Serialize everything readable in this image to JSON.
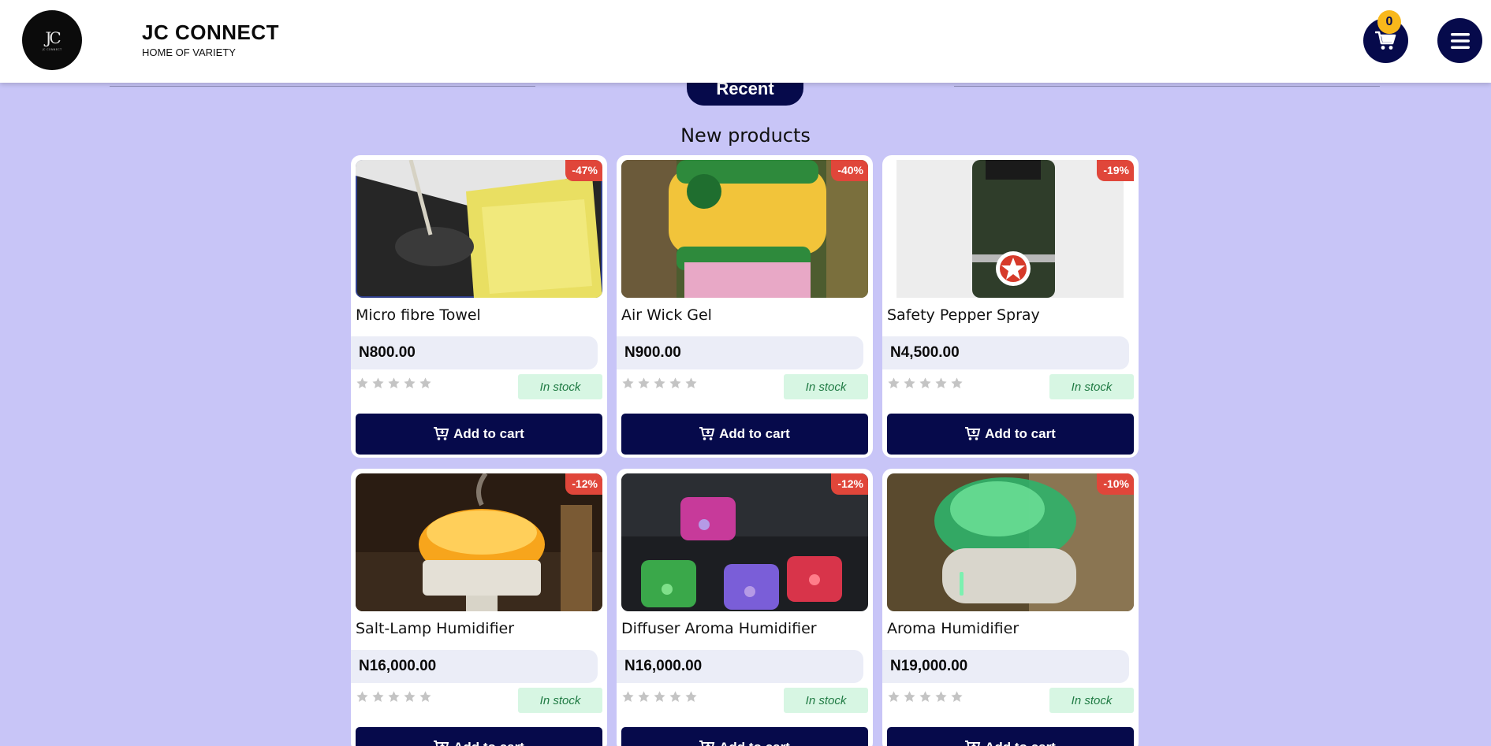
{
  "header": {
    "logo_mark": "JC",
    "logo_text": "JC CONNECT",
    "title": "JC CONNECT",
    "tagline": "HOME OF VARIETY",
    "cart_count": "0",
    "cart_icon": "cart-icon",
    "menu_icon": "hamburger-menu-icon"
  },
  "section": {
    "pill_label": "Recent",
    "title": "New products"
  },
  "colors": {
    "page_bg": "#c8c5f7",
    "navy": "#060a4b",
    "discount": "#e0463a",
    "badge": "#f9b81b",
    "stock_bg": "#d7f6e3",
    "stock_text": "#1f7a43"
  },
  "products": [
    {
      "name": "Micro fibre Towel",
      "price": "N800.00",
      "discount": "-47%",
      "stock": "In stock",
      "button": "Add to cart",
      "rating": 0
    },
    {
      "name": "Air Wick Gel",
      "price": "N900.00",
      "discount": "-40%",
      "stock": "In stock",
      "button": "Add to cart",
      "rating": 0
    },
    {
      "name": "Safety Pepper Spray",
      "price": "N4,500.00",
      "discount": "-19%",
      "stock": "In stock",
      "button": "Add to cart",
      "rating": 0
    },
    {
      "name": "Salt-Lamp Humidifier",
      "price": "N16,000.00",
      "discount": "-12%",
      "stock": "In stock",
      "button": "Add to cart",
      "rating": 0
    },
    {
      "name": "Diffuser Aroma Humidifier",
      "price": "N16,000.00",
      "discount": "-12%",
      "stock": "In stock",
      "button": "Add to cart",
      "rating": 0
    },
    {
      "name": "Aroma Humidifier",
      "price": "N19,000.00",
      "discount": "-10%",
      "stock": "In stock",
      "button": "Add to cart",
      "rating": 0
    }
  ]
}
